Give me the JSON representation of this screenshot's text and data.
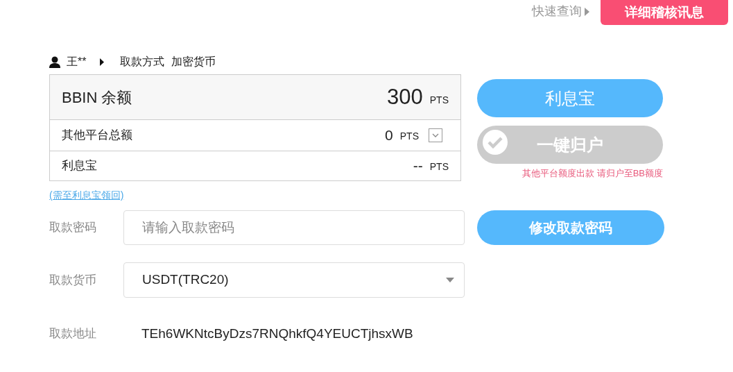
{
  "top_bar": {
    "quick_query": "快速查询",
    "audit_button": "详细稽核讯息"
  },
  "breadcrumb": {
    "user": "王**",
    "method_label": "取款方式",
    "method": "加密货币"
  },
  "balances": [
    {
      "kind": "main",
      "label": "BBIN 余额",
      "amount": "300",
      "unit": "PTS"
    },
    {
      "kind": "dropdown",
      "label": "其他平台总额",
      "amount": "0",
      "unit": "PTS",
      "expanded": false
    },
    {
      "kind": "plain",
      "label": "利息宝",
      "amount": "--",
      "unit": "PTS"
    }
  ],
  "interest_link": "(需至利息宝领回)",
  "interest_button": "利息宝",
  "consolidate_button": {
    "label": "一键归户",
    "disabled": true
  },
  "consolidate_note": "其他平台额度出款 请归户至BB额度",
  "form": [
    {
      "kind": "password",
      "label": "取款密码",
      "placeholder": "请输入取款密码",
      "button": "修改取款密码"
    },
    {
      "kind": "select",
      "label": "取款货币",
      "value": "USDT(TRC20)"
    },
    {
      "kind": "text",
      "label": "取款地址",
      "value": "TEh6WKNtcByDzs7RNQhkfQ4YEUCTjhsxWB"
    }
  ]
}
